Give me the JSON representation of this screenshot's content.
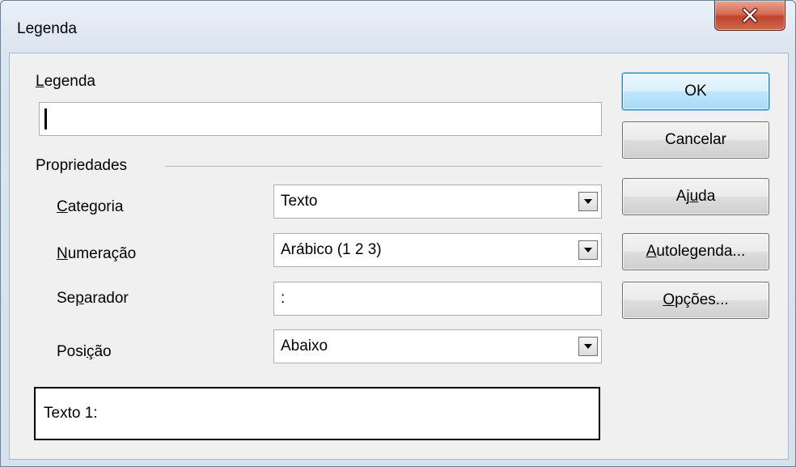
{
  "window": {
    "title": "Legenda"
  },
  "caption": {
    "label_u": "L",
    "label_rest": "egenda",
    "value": ""
  },
  "properties": {
    "group_label": "Propriedades",
    "category": {
      "label_u": "C",
      "label_rest": "ategoria",
      "value": "Texto"
    },
    "numbering": {
      "label_u": "N",
      "label_rest": "umeração",
      "value": "Arábico (1 2 3)"
    },
    "separator": {
      "label_pre": "Se",
      "label_u": "p",
      "label_rest": "arador",
      "value": ":"
    },
    "position": {
      "label_pre": "Posi",
      "label_u": "ç",
      "label_rest": "ão",
      "value": "Abaixo"
    }
  },
  "preview": {
    "text": "Texto 1:"
  },
  "buttons": {
    "ok": "OK",
    "cancel": "Cancelar",
    "help_pre": "Aj",
    "help_u": "u",
    "help_rest": "da",
    "autocaption_u": "A",
    "autocaption_rest": "utolegenda...",
    "options_u": "O",
    "options_rest": "pções..."
  },
  "colors": {
    "close_button": "#c2422b",
    "default_button_border": "#3c7fb1"
  },
  "icons": {
    "close": "close-x-icon",
    "dropdown": "chevron-down-icon"
  }
}
